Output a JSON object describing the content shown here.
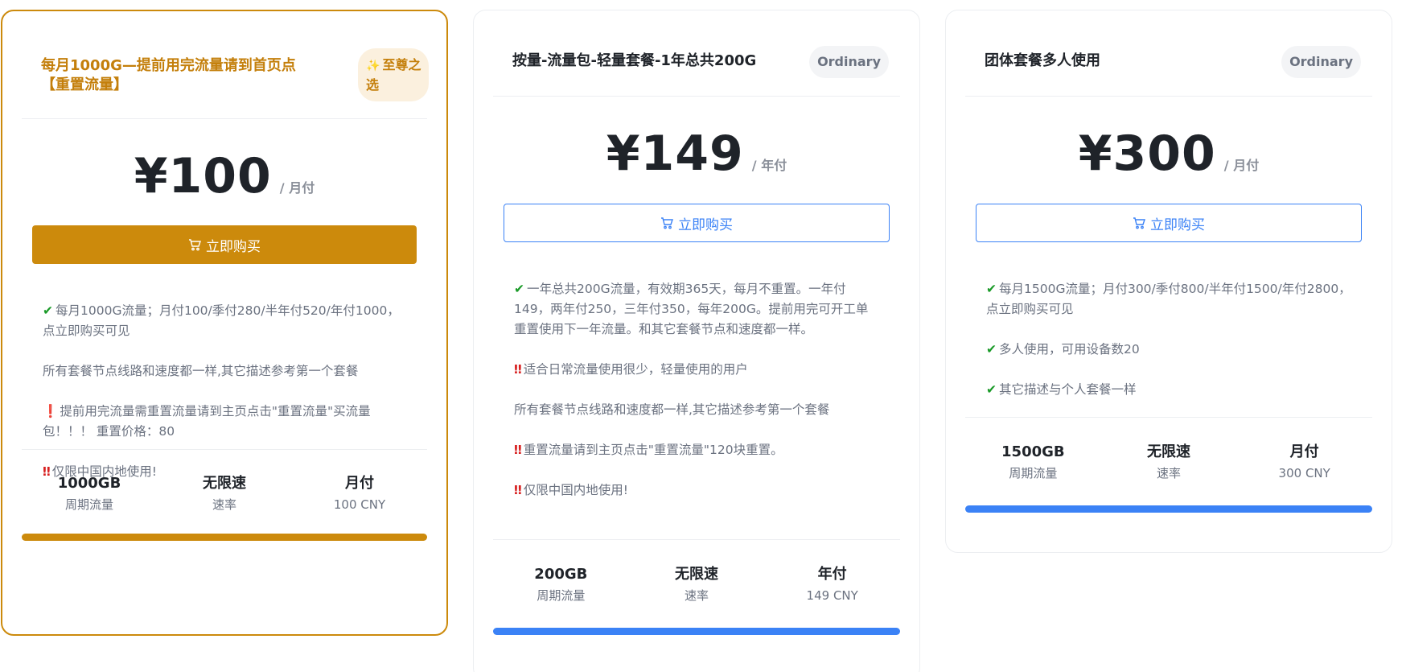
{
  "plans": [
    {
      "title": "每月1000G—提前用完流量请到首页点【重置流量】",
      "badge": "至尊之选",
      "price": "¥100",
      "period": "/ 月付",
      "buy_label": "立即购买",
      "features": [
        {
          "icon": "check-icon",
          "text": "每月1000G流量；月付100/季付280/半年付520/年付1000，点立即购买可见"
        },
        {
          "icon": "",
          "text": "所有套餐节点线路和速度都一样,其它描述参考第一个套餐"
        },
        {
          "icon": "exclamation-icon",
          "text": "提前用完流量需重置流量请到主页点击\"重置流量\"买流量包！！！ 重置价格：80"
        },
        {
          "icon": "double-exclamation-icon",
          "text": "仅限中国内地使用!"
        }
      ],
      "stats": [
        {
          "value": "1000GB",
          "label": "周期流量"
        },
        {
          "value": "无限速",
          "label": "速率"
        },
        {
          "value": "月付",
          "label": "100 CNY"
        }
      ]
    },
    {
      "title": "按量-流量包-轻量套餐-1年总共200G",
      "badge": "Ordinary",
      "price": "¥149",
      "period": "/ 年付",
      "buy_label": "立即购买",
      "features": [
        {
          "icon": "check-icon",
          "text": "一年总共200G流量，有效期365天，每月不重置。一年付149，两年付250，三年付350，每年200G。提前用完可开工单重置使用下一年流量。和其它套餐节点和速度都一样。"
        },
        {
          "icon": "double-exclamation-icon",
          "text": "适合日常流量使用很少，轻量使用的用户"
        },
        {
          "icon": "",
          "text": "所有套餐节点线路和速度都一样,其它描述参考第一个套餐"
        },
        {
          "icon": "double-exclamation-icon",
          "text": "重置流量请到主页点击\"重置流量\"120块重置。"
        },
        {
          "icon": "double-exclamation-icon",
          "text": "仅限中国内地使用!"
        }
      ],
      "stats": [
        {
          "value": "200GB",
          "label": "周期流量"
        },
        {
          "value": "无限速",
          "label": "速率"
        },
        {
          "value": "年付",
          "label": "149 CNY"
        }
      ]
    },
    {
      "title": "团体套餐多人使用",
      "badge": "Ordinary",
      "price": "¥300",
      "period": "/ 月付",
      "buy_label": "立即购买",
      "features": [
        {
          "icon": "check-icon",
          "text": "每月1500G流量；月付300/季付800/半年付1500/年付2800，点立即购买可见"
        },
        {
          "icon": "check-icon",
          "text": "多人使用，可用设备数20"
        },
        {
          "icon": "check-icon",
          "text": "其它描述与个人套餐一样"
        }
      ],
      "stats": [
        {
          "value": "1500GB",
          "label": "周期流量"
        },
        {
          "value": "无限速",
          "label": "速率"
        },
        {
          "value": "月付",
          "label": "300 CNY"
        }
      ]
    }
  ],
  "colors": {
    "featured_accent": "#cc8a0c",
    "primary_blue": "#3b82f6"
  }
}
